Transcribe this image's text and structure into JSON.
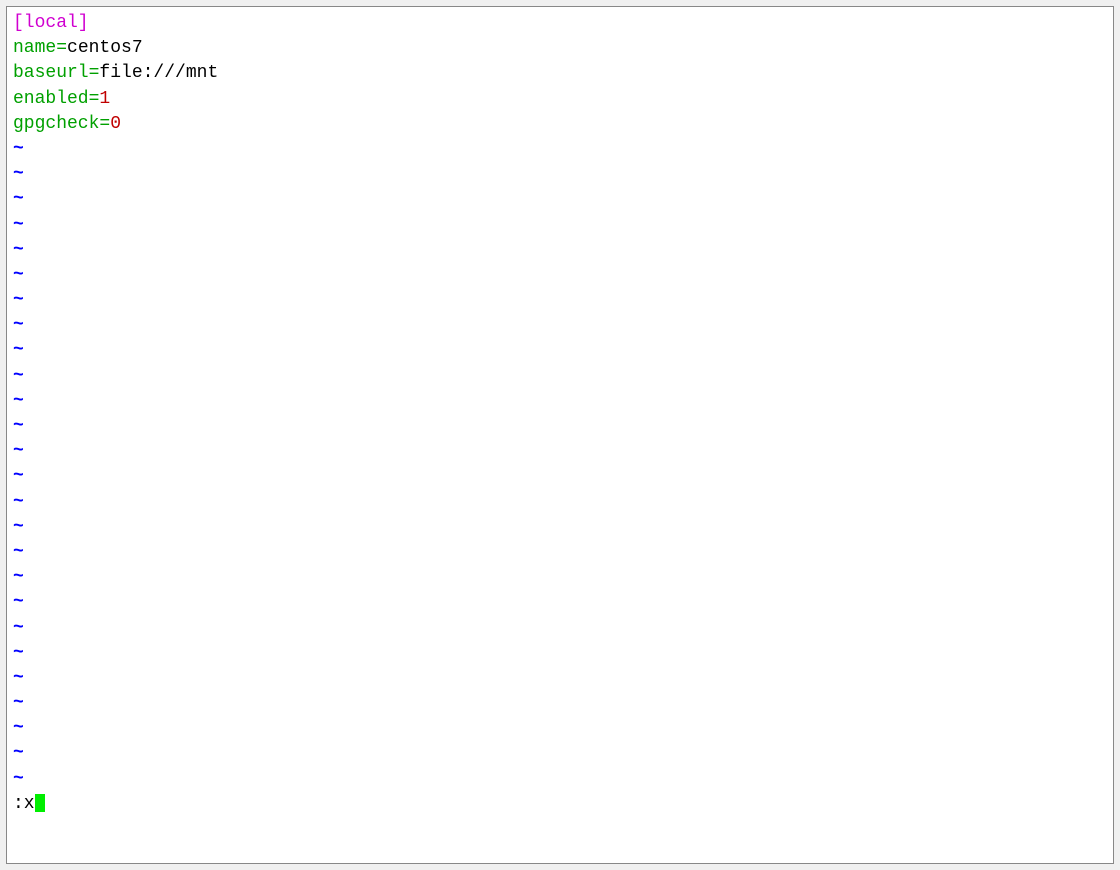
{
  "editor": {
    "lines": [
      {
        "section": "[local]"
      },
      {
        "key": "name=",
        "value": "centos7",
        "valueColor": "black"
      },
      {
        "key": "baseurl=",
        "value": "file:///mnt",
        "valueColor": "black"
      },
      {
        "key": "enabled=",
        "value": "1",
        "valueColor": "red"
      },
      {
        "key": "gpgcheck=",
        "value": "0",
        "valueColor": "red"
      }
    ],
    "tilde": "~",
    "tilde_count": 26,
    "command": ":x"
  }
}
